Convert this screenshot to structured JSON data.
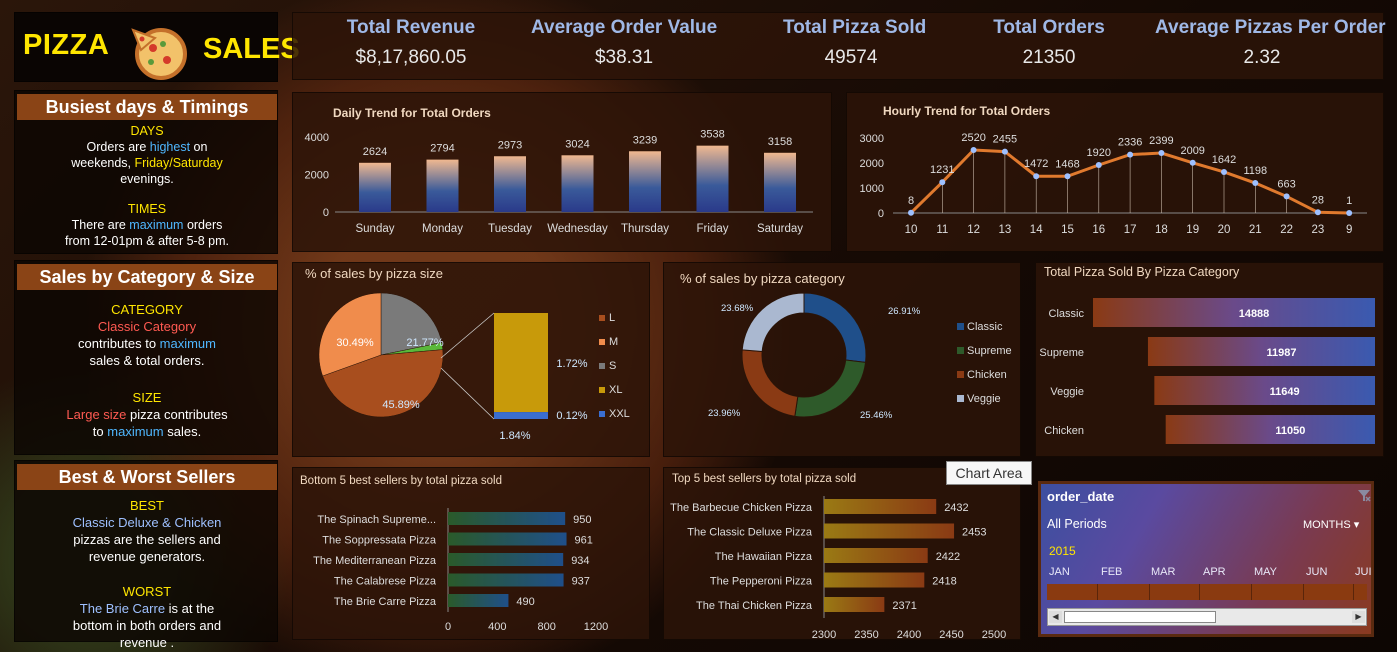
{
  "logo": {
    "pizza": "PIZZA",
    "sales": "SALES"
  },
  "kpis": [
    {
      "title": "Total Revenue",
      "value": "$8,17,860.05"
    },
    {
      "title": "Average Order Value",
      "value": "$38.31"
    },
    {
      "title": "Total Pizza Sold",
      "value": "49574"
    },
    {
      "title": "Total Orders",
      "value": "21350"
    },
    {
      "title": "Average Pizzas Per Order",
      "value": "2.32"
    }
  ],
  "side": {
    "busiest": {
      "header": "Busiest days & Timings",
      "days_label": "DAYS",
      "days_l1a": "Orders are ",
      "days_l1b": "highest",
      "days_l1c": " on",
      "days_l2a": "weekends, ",
      "days_l2b": "Friday/Saturday",
      "days_l3": "evenings.",
      "times_label": "TIMES",
      "times_l1a": "There are ",
      "times_l1b": "maximum",
      "times_l1c": " orders",
      "times_l2": "from 12-01pm & after 5-8 pm."
    },
    "category": {
      "header": "Sales by Category & Size",
      "cat_label": "CATEGORY",
      "cat_l1": "Classic Category",
      "cat_l2a": "contributes to ",
      "cat_l2b": "maximum",
      "cat_l3": "sales & total orders.",
      "size_label": "SIZE",
      "size_l1a": "Large size",
      "size_l1b": " pizza contributes",
      "size_l2a": "to ",
      "size_l2b": "maximum",
      "size_l2c": " sales."
    },
    "sellers": {
      "header": "Best & Worst Sellers",
      "best_label": "BEST",
      "best_l1": "Classic Deluxe & Chicken",
      "best_l2": "pizzas are the sellers and",
      "best_l3": "revenue generators.",
      "worst_label": "WORST",
      "worst_l1a": "The Brie Carre",
      "worst_l1b": " is at the",
      "worst_l2": "bottom in both orders and",
      "worst_l3": "revenue ."
    }
  },
  "tooltip": "Chart Area",
  "slicer": {
    "field": "order_date",
    "all_periods": "All Periods",
    "months": "MONTHS",
    "year": "2015",
    "month_labels": [
      "JAN",
      "FEB",
      "MAR",
      "APR",
      "MAY",
      "JUN",
      "JUI"
    ]
  },
  "colors": {
    "accent": "#e07a2e",
    "blue": "#2f5fb0",
    "header": "#8a4416"
  },
  "chart_data": [
    {
      "type": "bar",
      "title": "Daily Trend for Total Orders",
      "categories": [
        "Sunday",
        "Monday",
        "Tuesday",
        "Wednesday",
        "Thursday",
        "Friday",
        "Saturday"
      ],
      "values": [
        2624,
        2794,
        2973,
        3024,
        3239,
        3538,
        3158
      ],
      "yticks": [
        "0",
        "2000",
        "4000"
      ],
      "ylim": [
        0,
        4000
      ]
    },
    {
      "type": "line",
      "title": "Hourly Trend for Total Orders",
      "categories": [
        "10",
        "11",
        "12",
        "13",
        "14",
        "15",
        "16",
        "17",
        "18",
        "19",
        "20",
        "21",
        "22",
        "23",
        "9"
      ],
      "values": [
        8,
        1231,
        2520,
        2455,
        1472,
        1468,
        1920,
        2336,
        2399,
        2009,
        1642,
        1198,
        663,
        28,
        1
      ],
      "yticks": [
        "0",
        "1000",
        "2000",
        "3000"
      ],
      "ylim": [
        0,
        3000
      ]
    },
    {
      "type": "pie",
      "title": "% of sales by pizza size",
      "slices": [
        {
          "label": "L",
          "value": 45.89,
          "text": "45.89%",
          "color": "#a84e1e"
        },
        {
          "label": "M",
          "value": 30.49,
          "text": "30.49%",
          "color": "#f08c4c"
        },
        {
          "label": "S",
          "value": 21.77,
          "text": "21.77%",
          "color": "#7a7a7a"
        },
        {
          "label": "XL",
          "value": 1.72,
          "text": "1.72%",
          "color": "#c89a0a"
        },
        {
          "label": "XXL",
          "value": 0.12,
          "text": "0.12%",
          "color": "#3a6ed0"
        }
      ],
      "other_slice": {
        "value": 1.84,
        "text": "1.84%",
        "color": "#5ab83a"
      },
      "legend": [
        "L",
        "M",
        "S",
        "XL",
        "XXL"
      ]
    },
    {
      "type": "pie",
      "title": "% of sales by pizza category",
      "slices": [
        {
          "label": "Classic",
          "value": 26.91,
          "text": "26.91%",
          "color": "#1f4f8a"
        },
        {
          "label": "Supreme",
          "value": 25.46,
          "text": "25.46%",
          "color": "#2e5a2a"
        },
        {
          "label": "Chicken",
          "value": 23.96,
          "text": "23.96%",
          "color": "#8a3a14"
        },
        {
          "label": "Veggie",
          "value": 23.68,
          "text": "23.68%",
          "color": "#aab8d0"
        }
      ]
    },
    {
      "type": "bar",
      "title": "Total Pizza Sold By Pizza Category",
      "categories": [
        "Classic",
        "Supreme",
        "Veggie",
        "Chicken"
      ],
      "values": [
        14888,
        11987,
        11649,
        11050
      ]
    },
    {
      "type": "bar",
      "title": "Bottom 5 best sellers by total pizza sold",
      "categories": [
        "The Spinach Supreme...",
        "The Soppressata Pizza",
        "The Mediterranean Pizza",
        "The Calabrese Pizza",
        "The Brie Carre Pizza"
      ],
      "values": [
        950,
        961,
        934,
        937,
        490
      ],
      "xticks": [
        "0",
        "400",
        "800",
        "1200"
      ],
      "xlim": [
        0,
        1200
      ]
    },
    {
      "type": "bar",
      "title": "Top 5 best sellers by total pizza sold",
      "categories": [
        "The Barbecue Chicken Pizza",
        "The Classic Deluxe Pizza",
        "The Hawaiian Pizza",
        "The Pepperoni Pizza",
        "The Thai Chicken Pizza"
      ],
      "values": [
        2432,
        2453,
        2422,
        2418,
        2371
      ],
      "xticks": [
        "2300",
        "2350",
        "2400",
        "2450",
        "2500"
      ],
      "xlim": [
        2300,
        2500
      ]
    }
  ]
}
